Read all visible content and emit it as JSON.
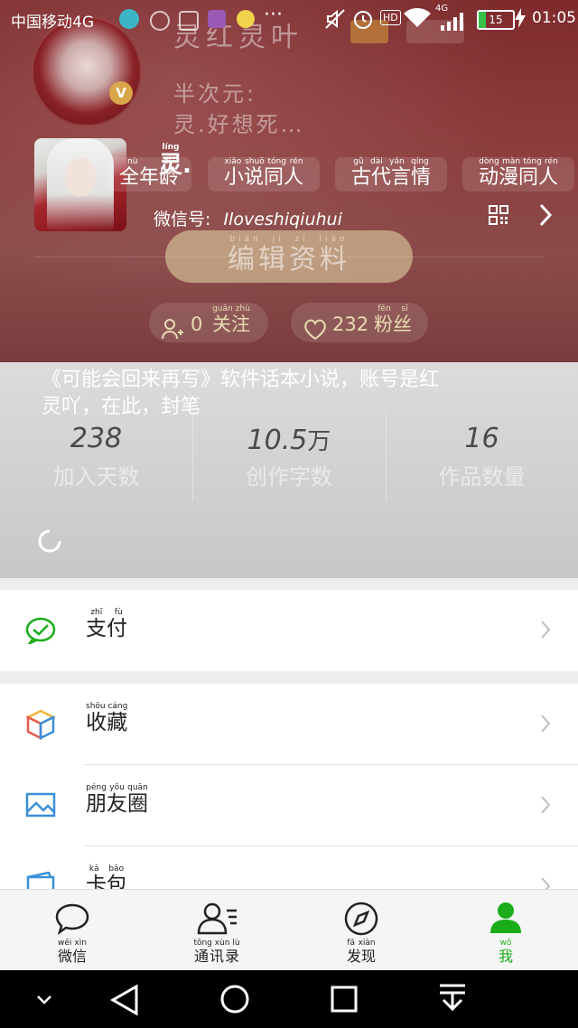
{
  "status_bar": {
    "carrier": "中国移动4G",
    "time": "01:05",
    "battery": "15",
    "network_label": "4G",
    "hd_label": "HD"
  },
  "profile": {
    "bg_name": "灵红灵叶",
    "bg_bio_line1": "半次元:",
    "bg_bio_line2": "灵.好想死…",
    "v_badge": "V",
    "name_prefix": "灵",
    "name_suffix": ".",
    "wechat_id_label": "微信号:",
    "wechat_id": "Iloveshiqiuhui",
    "tags": [
      "全年龄",
      "小说同人",
      "古代言情",
      "动漫同人"
    ],
    "tags_pinyin": [
      "nù dì",
      "xiǎo shuō tóng rén",
      "gǔ dài yán qíng",
      "dòng màn tóng rén"
    ],
    "edit_button": "编辑资料",
    "follow_count": "0",
    "follow_label": "关注",
    "fans_count": "232",
    "fans_label": "粉丝"
  },
  "notice": {
    "line1": "《可能会回来再写》软件话本小说，账号是红",
    "line2": "灵吖，在此，封笔"
  },
  "stats": [
    {
      "value": "238",
      "label": "加入天数"
    },
    {
      "value": "10.5",
      "unit": "万",
      "label": "创作字数"
    },
    {
      "value": "16",
      "label": "作品数量"
    }
  ],
  "menu": {
    "pay": "支付",
    "favorites": "收藏",
    "moments": "朋友圈",
    "cards": "卡包"
  },
  "tabs": {
    "wechat": "微信",
    "contacts": "通讯录",
    "discover": "发现",
    "me": "我"
  },
  "colors": {
    "accent_green": "#1aad19",
    "header_red": "#8c3a3a"
  }
}
